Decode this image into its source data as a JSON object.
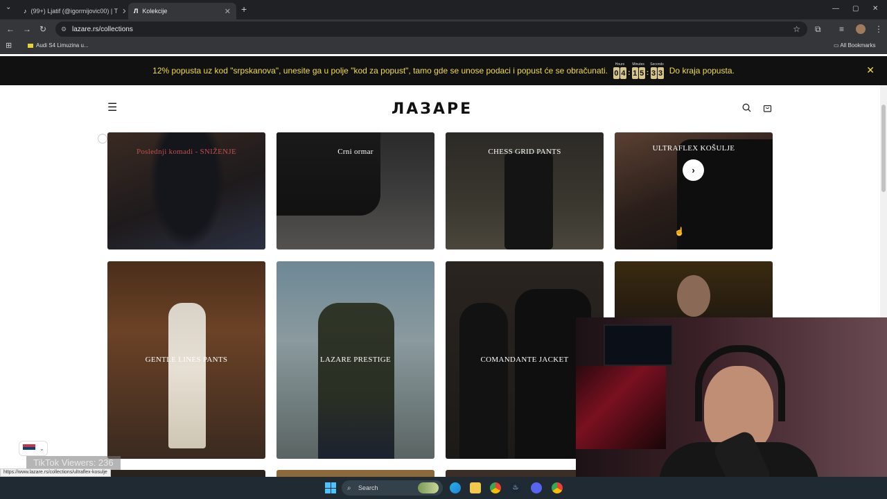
{
  "browser": {
    "tabs": [
      {
        "label": "(99+) Ljatif (@igormijovic00) | T"
      },
      {
        "label": "Kolekcije"
      }
    ],
    "address": "lazare.rs/collections",
    "bookmark": "Audi S4 Limuzina u...",
    "all_bookmarks": "All Bookmarks"
  },
  "promo": {
    "text": "12% popusta uz kod \"srpskanova\", unesite ga u polje \"kod za popust\", tamo gde se unose podaci i popust će se obračunati.",
    "countdown": {
      "hours_label": "Hours",
      "minutes_label": "Minutes",
      "seconds_label": "Seconds",
      "hours": [
        "0",
        "4"
      ],
      "minutes": [
        "1",
        "5"
      ],
      "seconds": [
        "3",
        "3"
      ]
    },
    "suffix": "Do kraja popusta.",
    "accent": "#f0dd3a"
  },
  "site": {
    "logo": "ЛАЗАРЕ"
  },
  "collections": [
    {
      "title": "Poslednji komadi - SNIŽENJE",
      "color": "#c0504d"
    },
    {
      "title": "Crni ormar",
      "color": "#ffffff"
    },
    {
      "title": "CHESS GRID PANTS",
      "color": "#ffffff"
    },
    {
      "title": "ULTRAFLEX KOŠULJE",
      "color": "#ffffff"
    },
    {
      "title": "GENTLE LINES PANTS",
      "color": "#ffffff"
    },
    {
      "title": "LAZARE PRESTIGE",
      "color": "#ffffff"
    },
    {
      "title": "COMANDANTE JACKET",
      "color": "#ffffff"
    },
    {
      "title": "",
      "color": "#ffffff"
    }
  ],
  "overlay": {
    "status_url": "https://www.lazare.rs/collections/ultraflex-kosulje",
    "tiktok": "TikTok Viewers: 236"
  },
  "taskbar": {
    "search": "Search"
  }
}
